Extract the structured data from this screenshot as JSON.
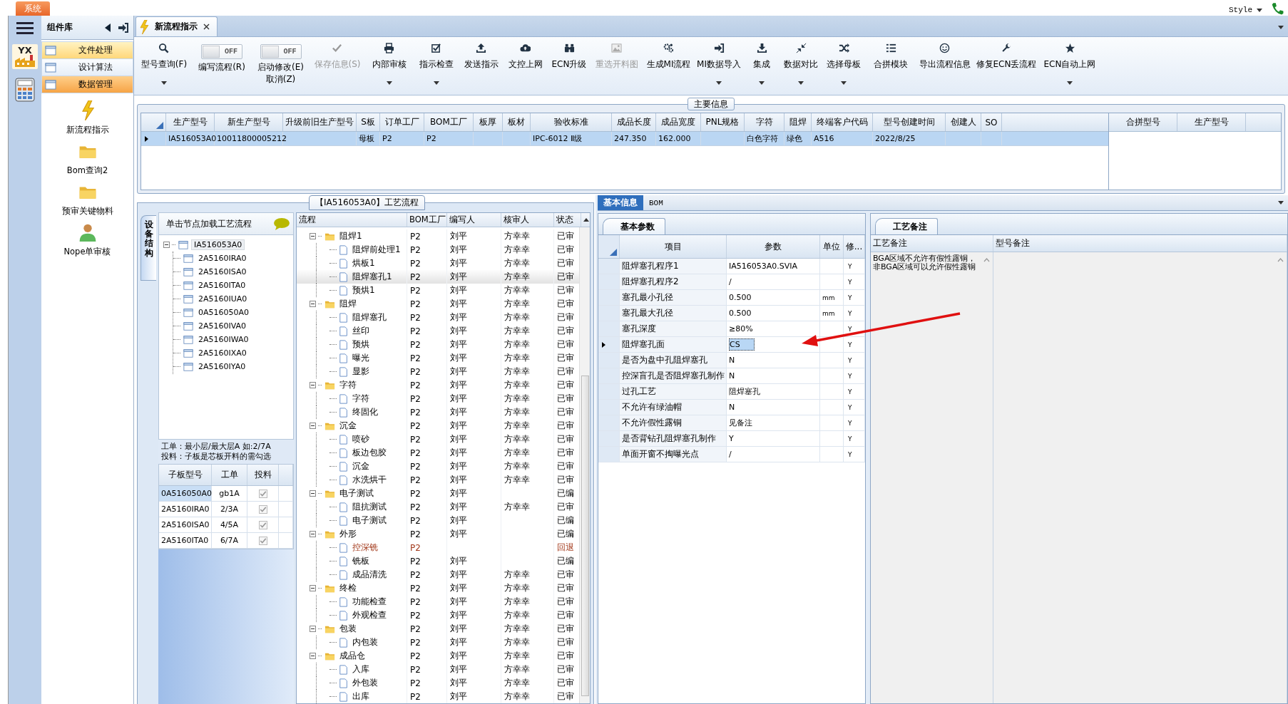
{
  "window": {
    "system_tab": "系统",
    "style_menu": "Style"
  },
  "nav_rail": {
    "logo_text": "YX"
  },
  "component_library": {
    "title": "组件库",
    "categories": [
      {
        "label": "文件处理",
        "selected": true,
        "hovered": false
      },
      {
        "label": "设计算法",
        "selected": false,
        "hovered": false
      },
      {
        "label": "数据管理",
        "selected": false,
        "hovered": true
      }
    ],
    "tools": [
      "新流程指示",
      "Bom查询2",
      "预审关键物料",
      "Nope单审核"
    ]
  },
  "document_tabs": [
    {
      "label": "新流程指示",
      "selected": true
    }
  ],
  "toolbar": [
    {
      "kind": "button",
      "label": "型号查询(F)",
      "dropdown": true,
      "disabled": false
    },
    {
      "kind": "toggle",
      "label": "编写流程(R)",
      "switch_text": "OFF",
      "on": false
    },
    {
      "kind": "toggle",
      "label": "启动修改(E)",
      "label_2": "取消(Z)",
      "switch_text": "OFF",
      "on": false
    },
    {
      "kind": "button",
      "label": "保存信息(S)",
      "dropdown": false,
      "disabled": true
    },
    {
      "kind": "button",
      "label": "内部审核",
      "dropdown": true,
      "disabled": false
    },
    {
      "kind": "button",
      "label": "指示检查",
      "dropdown": true,
      "disabled": false
    },
    {
      "kind": "button",
      "label": "发送指示",
      "dropdown": false,
      "disabled": false
    },
    {
      "kind": "button",
      "label": "文控上网",
      "dropdown": false,
      "disabled": false
    },
    {
      "kind": "button",
      "label": "ECN升级",
      "dropdown": false,
      "disabled": false
    },
    {
      "kind": "button",
      "label": "重选开料图",
      "dropdown": false,
      "disabled": true
    },
    {
      "kind": "button",
      "label": "生成MI流程",
      "dropdown": false,
      "disabled": false
    },
    {
      "kind": "button",
      "label": "MI数据导入",
      "dropdown": true,
      "disabled": false
    },
    {
      "kind": "button",
      "label": "集成",
      "dropdown": true,
      "disabled": false
    },
    {
      "kind": "button",
      "label": "数据对比",
      "dropdown": true,
      "disabled": false
    },
    {
      "kind": "button",
      "label": "选择母板",
      "dropdown": true,
      "disabled": false
    },
    {
      "kind": "button",
      "label": "合拼模块",
      "dropdown": false,
      "disabled": false
    },
    {
      "kind": "button",
      "label": "导出流程信息",
      "dropdown": false,
      "disabled": false
    },
    {
      "kind": "button",
      "label": "修复ECN丢流程",
      "dropdown": false,
      "disabled": false
    },
    {
      "kind": "button",
      "label": "ECN自动上网",
      "dropdown": true,
      "disabled": false
    }
  ],
  "main_info": {
    "title": "主要信息",
    "columns": [
      "生产型号",
      "新生产型号",
      "升级前旧生产型号",
      "S板",
      "订单工厂",
      "BOM工厂",
      "板厚",
      "板材",
      "验收标准",
      "成品长度",
      "成品宽度",
      "PNL规格",
      "字符",
      "阻焊",
      "终端客户代码",
      "型号创建时间",
      "创建人",
      "SO"
    ],
    "rows": [
      {
        "selected": true,
        "cells": [
          "IA516053A0",
          "10011800005212",
          null,
          "母板",
          "P2",
          "P2",
          null,
          null,
          "IPC-6012 Ⅱ级",
          "247.350",
          "162.000",
          null,
          "白色字符",
          "绿色",
          "A516",
          "2022/8/25",
          null,
          null
        ]
      }
    ],
    "side_columns": [
      "合拼型号",
      "生产型号"
    ]
  },
  "structure_panel": {
    "side_tab": "设备结构",
    "header": "单击节点加载工艺流程",
    "tree": {
      "label": "IA516053A0",
      "selected": true,
      "expanded": true,
      "children": [
        {
          "label": "2A5160IRA0",
          "selected": false
        },
        {
          "label": "2A5160ISA0",
          "selected": false
        },
        {
          "label": "2A5160ITA0",
          "selected": false
        },
        {
          "label": "2A5160IUA0",
          "selected": false
        },
        {
          "label": "0A516050A0",
          "selected": false
        },
        {
          "label": "2A5160IVA0",
          "selected": false
        },
        {
          "label": "2A5160IWA0",
          "selected": false
        },
        {
          "label": "2A5160IXA0",
          "selected": false
        },
        {
          "label": "2A5160IYA0",
          "selected": false
        }
      ]
    },
    "notes": [
      "工单：最小层/最大层A 如:2/7A",
      "投料：子板是芯板开料的需勾选"
    ],
    "subboard_columns": [
      "子板型号",
      "工单",
      "投料"
    ],
    "subboards": [
      {
        "model": "0A516050A0",
        "work_order": "gb1A",
        "checked": true,
        "selected": true
      },
      {
        "model": "2A5160IRA0",
        "work_order": "2/3A",
        "checked": true,
        "selected": false
      },
      {
        "model": "2A5160ISA0",
        "work_order": "4/5A",
        "checked": true,
        "selected": false
      },
      {
        "model": "2A5160ITA0",
        "work_order": "6/7A",
        "checked": true,
        "selected": false
      }
    ]
  },
  "process_flow": {
    "title": "【IA516053A0】工艺流程",
    "columns": [
      "流程",
      "BOM工厂",
      "编写人",
      "核审人",
      "状态"
    ],
    "steps": [
      {
        "name": "阻焊1",
        "bom": "P2",
        "writer": "刘平",
        "reviewer": "方幸幸",
        "status": "已审",
        "returned": false,
        "selected": false,
        "expanded": true,
        "children": [
          {
            "name": "阻焊前处理1",
            "bom": "P2",
            "writer": "刘平",
            "reviewer": "方幸幸",
            "status": "已审",
            "returned": false,
            "selected": false
          },
          {
            "name": "烘板1",
            "bom": "P2",
            "writer": "刘平",
            "reviewer": "方幸幸",
            "status": "已审",
            "returned": false,
            "selected": false
          },
          {
            "name": "阻焊塞孔1",
            "bom": "P2",
            "writer": "刘平",
            "reviewer": "方幸幸",
            "status": "已审",
            "returned": false,
            "selected": true
          },
          {
            "name": "预烘1",
            "bom": "P2",
            "writer": "刘平",
            "reviewer": "方幸幸",
            "status": "已审",
            "returned": false,
            "selected": false
          }
        ]
      },
      {
        "name": "阻焊",
        "bom": "P2",
        "writer": "刘平",
        "reviewer": "方幸幸",
        "status": "已审",
        "returned": false,
        "selected": false,
        "expanded": true,
        "children": [
          {
            "name": "阻焊塞孔",
            "bom": "P2",
            "writer": "刘平",
            "reviewer": "方幸幸",
            "status": "已审",
            "returned": false,
            "selected": false
          },
          {
            "name": "丝印",
            "bom": "P2",
            "writer": "刘平",
            "reviewer": "方幸幸",
            "status": "已审",
            "returned": false,
            "selected": false
          },
          {
            "name": "预烘",
            "bom": "P2",
            "writer": "刘平",
            "reviewer": "方幸幸",
            "status": "已审",
            "returned": false,
            "selected": false
          },
          {
            "name": "曝光",
            "bom": "P2",
            "writer": "刘平",
            "reviewer": "方幸幸",
            "status": "已审",
            "returned": false,
            "selected": false
          },
          {
            "name": "显影",
            "bom": "P2",
            "writer": "刘平",
            "reviewer": "方幸幸",
            "status": "已审",
            "returned": false,
            "selected": false
          }
        ]
      },
      {
        "name": "字符",
        "bom": "P2",
        "writer": "刘平",
        "reviewer": "方幸幸",
        "status": "已审",
        "returned": false,
        "selected": false,
        "expanded": true,
        "children": [
          {
            "name": "字符",
            "bom": "P2",
            "writer": "刘平",
            "reviewer": "方幸幸",
            "status": "已审",
            "returned": false,
            "selected": false
          },
          {
            "name": "终固化",
            "bom": "P2",
            "writer": "刘平",
            "reviewer": "方幸幸",
            "status": "已审",
            "returned": false,
            "selected": false
          }
        ]
      },
      {
        "name": "沉金",
        "bom": "P2",
        "writer": "刘平",
        "reviewer": "方幸幸",
        "status": "已审",
        "returned": false,
        "selected": false,
        "expanded": true,
        "children": [
          {
            "name": "喷砂",
            "bom": "P2",
            "writer": "刘平",
            "reviewer": "方幸幸",
            "status": "已审",
            "returned": false,
            "selected": false
          },
          {
            "name": "板边包胶",
            "bom": "P2",
            "writer": "刘平",
            "reviewer": "方幸幸",
            "status": "已审",
            "returned": false,
            "selected": false
          },
          {
            "name": "沉金",
            "bom": "P2",
            "writer": "刘平",
            "reviewer": "方幸幸",
            "status": "已审",
            "returned": false,
            "selected": false
          },
          {
            "name": "水洗烘干",
            "bom": "P2",
            "writer": "刘平",
            "reviewer": "方幸幸",
            "status": "已审",
            "returned": false,
            "selected": false
          }
        ]
      },
      {
        "name": "电子测试",
        "bom": "P2",
        "writer": "刘平",
        "status": "已编",
        "returned": false,
        "selected": false,
        "expanded": true,
        "children": [
          {
            "name": "阻抗测试",
            "bom": "P2",
            "writer": "刘平",
            "reviewer": "方幸幸",
            "status": "已审",
            "returned": false,
            "selected": false
          },
          {
            "name": "电子测试",
            "bom": "P2",
            "writer": "刘平",
            "status": "已编",
            "returned": false,
            "selected": false
          }
        ]
      },
      {
        "name": "外形",
        "bom": "P2",
        "writer": "刘平",
        "status": "已编",
        "returned": false,
        "selected": false,
        "expanded": true,
        "children": [
          {
            "name": "控深铣",
            "bom": "P2",
            "status": "回退",
            "returned": true,
            "selected": false
          },
          {
            "name": "铣板",
            "bom": "P2",
            "writer": "刘平",
            "status": "已编",
            "returned": false,
            "selected": false
          },
          {
            "name": "成品清洗",
            "bom": "P2",
            "writer": "刘平",
            "reviewer": "方幸幸",
            "status": "已审",
            "returned": false,
            "selected": false
          }
        ]
      },
      {
        "name": "终检",
        "bom": "P2",
        "writer": "刘平",
        "reviewer": "方幸幸",
        "status": "已审",
        "returned": false,
        "selected": false,
        "expanded": true,
        "children": [
          {
            "name": "功能检查",
            "bom": "P2",
            "writer": "刘平",
            "reviewer": "方幸幸",
            "status": "已审",
            "returned": false,
            "selected": false
          },
          {
            "name": "外观检查",
            "bom": "P2",
            "writer": "刘平",
            "reviewer": "方幸幸",
            "status": "已审",
            "returned": false,
            "selected": false
          }
        ]
      },
      {
        "name": "包装",
        "bom": "P2",
        "writer": "刘平",
        "reviewer": "方幸幸",
        "status": "已审",
        "returned": false,
        "selected": false,
        "expanded": true,
        "children": [
          {
            "name": "内包装",
            "bom": "P2",
            "writer": "刘平",
            "reviewer": "方幸幸",
            "status": "已审",
            "returned": false,
            "selected": false
          }
        ]
      },
      {
        "name": "成品仓",
        "bom": "P2",
        "writer": "刘平",
        "reviewer": "方幸幸",
        "status": "已审",
        "returned": false,
        "selected": false,
        "expanded": true,
        "children": [
          {
            "name": "入库",
            "bom": "P2",
            "writer": "刘平",
            "reviewer": "方幸幸",
            "status": "已审",
            "returned": false,
            "selected": false
          },
          {
            "name": "外包装",
            "bom": "P2",
            "writer": "刘平",
            "reviewer": "方幸幸",
            "status": "已审",
            "returned": false,
            "selected": false
          },
          {
            "name": "出库",
            "bom": "P2",
            "writer": "刘平",
            "reviewer": "方幸幸",
            "status": "已审",
            "returned": false,
            "selected": false
          }
        ]
      }
    ]
  },
  "detail_tabs": [
    {
      "label": "基本信息",
      "selected": true
    },
    {
      "label": "BOM",
      "selected": false
    }
  ],
  "basic_params": {
    "tab": "基本参数",
    "columns": [
      "项目",
      "参数",
      "单位",
      "修..."
    ],
    "rows": [
      {
        "item": "阻焊塞孔程序1",
        "value": "IA516053A0.SVIA",
        "flag": "Y",
        "selected": false
      },
      {
        "item": "阻焊塞孔程序2",
        "value": "/",
        "flag": "Y",
        "selected": false
      },
      {
        "item": "塞孔最小孔径",
        "value": "0.500",
        "unit": "mm",
        "flag": "Y",
        "selected": false
      },
      {
        "item": "塞孔最大孔径",
        "value": "0.500",
        "unit": "mm",
        "flag": "Y",
        "selected": false
      },
      {
        "item": "塞孔深度",
        "value": "≥80%",
        "flag": "Y",
        "selected": false
      },
      {
        "item": "阻焊塞孔面",
        "value": "CS",
        "flag": "Y",
        "selected": true
      },
      {
        "item": "是否为盘中孔阻焊塞孔",
        "value": "N",
        "flag": "Y",
        "selected": false
      },
      {
        "item": "控深盲孔是否阻焊塞孔制作",
        "value": "N",
        "flag": "Y",
        "selected": false
      },
      {
        "item": "过孔工艺",
        "value": "阻焊塞孔",
        "flag": "Y",
        "selected": false
      },
      {
        "item": "不允许有绿油帽",
        "value": "N",
        "flag": "Y",
        "selected": false
      },
      {
        "item": "不允许假性露铜",
        "value": "见备注",
        "flag": "Y",
        "selected": false
      },
      {
        "item": "是否背钻孔阻焊塞孔制作",
        "value": "Y",
        "flag": "Y",
        "selected": false
      },
      {
        "item": "单面开窗不掏曝光点",
        "value": "/",
        "flag": "Y",
        "selected": false
      }
    ]
  },
  "process_notes": {
    "tab": "工艺备注",
    "columns": [
      "工艺备注",
      "型号备注"
    ],
    "process_note": "BGA区域不允许有假性露铜，非BGA区域可以允许假性露铜"
  }
}
